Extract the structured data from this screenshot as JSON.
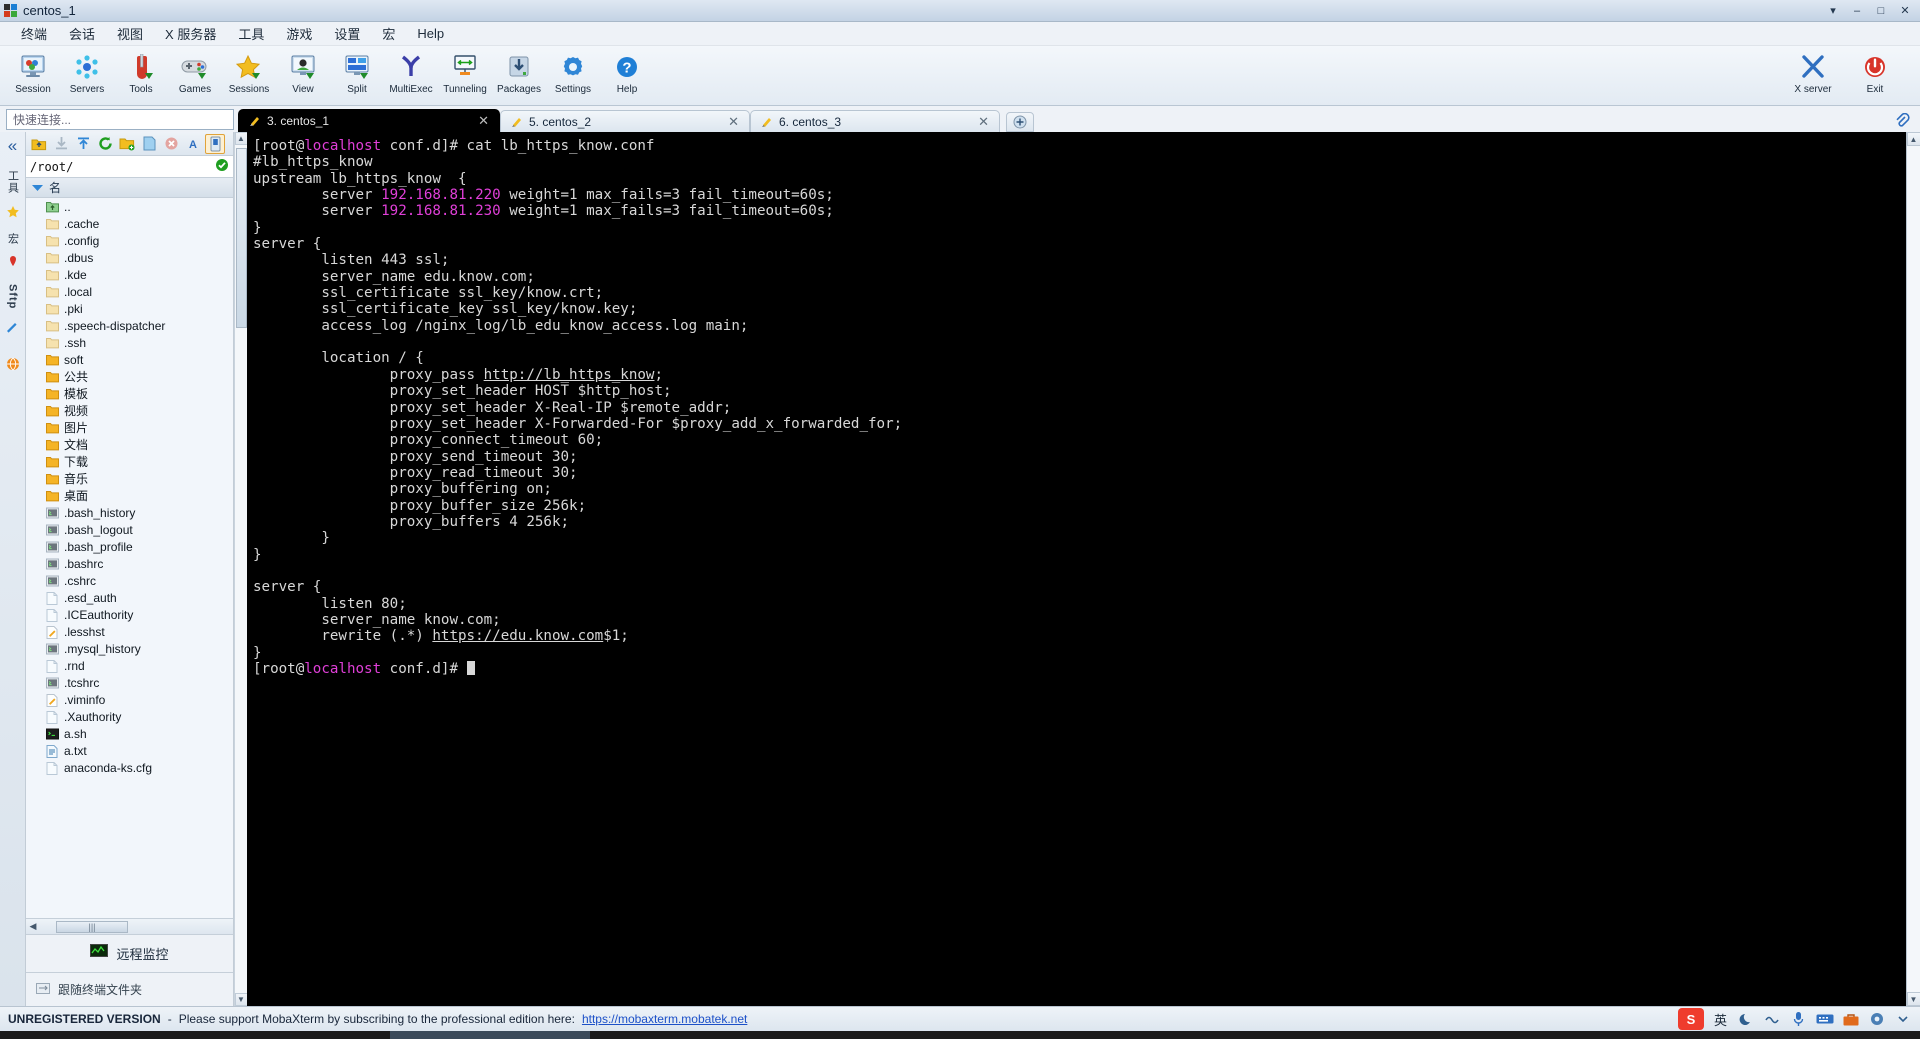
{
  "window": {
    "title": "centos_1",
    "buttons": [
      "▾",
      "–",
      "□",
      "✕"
    ]
  },
  "menu": {
    "items": [
      "终端",
      "会话",
      "视图",
      "X 服务器",
      "工具",
      "游戏",
      "设置",
      "宏",
      "Help"
    ]
  },
  "toolbar": {
    "items": [
      {
        "label": "Session",
        "icon": "session-icon"
      },
      {
        "label": "Servers",
        "icon": "servers-icon"
      },
      {
        "label": "Tools",
        "icon": "tools-icon"
      },
      {
        "label": "Games",
        "icon": "games-icon"
      },
      {
        "label": "Sessions",
        "icon": "sessions-star-icon"
      },
      {
        "label": "View",
        "icon": "view-icon"
      },
      {
        "label": "Split",
        "icon": "split-icon"
      },
      {
        "label": "MultiExec",
        "icon": "multiexec-icon"
      },
      {
        "label": "Tunneling",
        "icon": "tunneling-icon"
      },
      {
        "label": "Packages",
        "icon": "packages-icon"
      },
      {
        "label": "Settings",
        "icon": "settings-gear-icon"
      },
      {
        "label": "Help",
        "icon": "help-question-icon"
      }
    ],
    "right": [
      {
        "label": "X server",
        "icon": "x-server-icon"
      },
      {
        "label": "Exit",
        "icon": "power-exit-icon"
      }
    ]
  },
  "quick_connect": {
    "placeholder": "快速连接..."
  },
  "tabs": {
    "items": [
      {
        "label": "3. centos_1",
        "active": true,
        "close": "✕"
      },
      {
        "label": "5. centos_2",
        "active": false,
        "close": "✕"
      },
      {
        "label": "6. centos_3",
        "active": false,
        "close": "✕"
      }
    ],
    "add_label": "+"
  },
  "left_rail": {
    "chevron": "«",
    "labels": [
      "工具",
      "宏"
    ],
    "sftp_label": "Sftp"
  },
  "sidebar": {
    "path": "/root/",
    "path_ok_icon": "check-circle-icon",
    "column_header": "名",
    "sort_icon": "sort-descending-icon",
    "toolbar_icons": [
      "parent-folder-icon",
      "download-icon",
      "upload-icon",
      "refresh-icon",
      "new-folder-icon",
      "new-file-icon",
      "delete-icon",
      "text-mode-icon",
      "binary-mode-icon"
    ],
    "files": [
      {
        "name": "..",
        "type": "parent"
      },
      {
        "name": ".cache",
        "type": "folder-dim"
      },
      {
        "name": ".config",
        "type": "folder-dim"
      },
      {
        "name": ".dbus",
        "type": "folder-dim"
      },
      {
        "name": ".kde",
        "type": "folder-dim"
      },
      {
        "name": ".local",
        "type": "folder-dim"
      },
      {
        "name": ".pki",
        "type": "folder-dim"
      },
      {
        "name": ".speech-dispatcher",
        "type": "folder-dim"
      },
      {
        "name": ".ssh",
        "type": "folder-dim"
      },
      {
        "name": "soft",
        "type": "folder"
      },
      {
        "name": "公共",
        "type": "folder"
      },
      {
        "name": "模板",
        "type": "folder"
      },
      {
        "name": "视频",
        "type": "folder"
      },
      {
        "name": "图片",
        "type": "folder"
      },
      {
        "name": "文档",
        "type": "folder"
      },
      {
        "name": "下载",
        "type": "folder"
      },
      {
        "name": "音乐",
        "type": "folder"
      },
      {
        "name": "桌面",
        "type": "folder"
      },
      {
        "name": ".bash_history",
        "type": "script"
      },
      {
        "name": ".bash_logout",
        "type": "script"
      },
      {
        "name": ".bash_profile",
        "type": "script"
      },
      {
        "name": ".bashrc",
        "type": "script"
      },
      {
        "name": ".cshrc",
        "type": "script"
      },
      {
        "name": ".esd_auth",
        "type": "file"
      },
      {
        "name": ".ICEauthority",
        "type": "file"
      },
      {
        "name": ".lesshst",
        "type": "edit"
      },
      {
        "name": ".mysql_history",
        "type": "script"
      },
      {
        "name": ".rnd",
        "type": "file"
      },
      {
        "name": ".tcshrc",
        "type": "script"
      },
      {
        "name": ".viminfo",
        "type": "edit"
      },
      {
        "name": ".Xauthority",
        "type": "file"
      },
      {
        "name": "a.sh",
        "type": "shell"
      },
      {
        "name": "a.txt",
        "type": "text"
      },
      {
        "name": "anaconda-ks.cfg",
        "type": "file"
      }
    ],
    "footer_button": "远程监控",
    "footer_monitor_icon": "monitor-chart-icon",
    "footer_follow": "跟随终端文件夹",
    "footer_follow_icon": "folder-sync-icon"
  },
  "terminal": {
    "prompt_user": "[root@",
    "prompt_host": "localhost",
    "prompt_tail": " conf.d]# ",
    "command": "cat lb_https_know.conf",
    "lines": [
      {
        "segs": [
          {
            "t": "[root@",
            "c": "w"
          },
          {
            "t": "localhost",
            "c": "m"
          },
          {
            "t": " conf.d]# cat lb_https_know.conf",
            "c": "w"
          }
        ]
      },
      {
        "segs": [
          {
            "t": "#lb_https_know",
            "c": "w"
          }
        ]
      },
      {
        "segs": [
          {
            "t": "upstream lb_https_know  {",
            "c": "w"
          }
        ]
      },
      {
        "segs": [
          {
            "t": "        server ",
            "c": "w"
          },
          {
            "t": "192.168.81.220",
            "c": "m"
          },
          {
            "t": " weight=1 max_fails=3 fail_timeout=60s;",
            "c": "w"
          }
        ]
      },
      {
        "segs": [
          {
            "t": "        server ",
            "c": "w"
          },
          {
            "t": "192.168.81.230",
            "c": "m"
          },
          {
            "t": " weight=1 max_fails=3 fail_timeout=60s;",
            "c": "w"
          }
        ]
      },
      {
        "segs": [
          {
            "t": "}",
            "c": "w"
          }
        ]
      },
      {
        "segs": [
          {
            "t": "server {",
            "c": "w"
          }
        ]
      },
      {
        "segs": [
          {
            "t": "        listen 443 ssl;",
            "c": "w"
          }
        ]
      },
      {
        "segs": [
          {
            "t": "        server_name edu.know.com;",
            "c": "w"
          }
        ]
      },
      {
        "segs": [
          {
            "t": "        ssl_certificate ssl_key/know.crt;",
            "c": "w"
          }
        ]
      },
      {
        "segs": [
          {
            "t": "        ssl_certificate_key ssl_key/know.key;",
            "c": "w"
          }
        ]
      },
      {
        "segs": [
          {
            "t": "        access_log /nginx_log/lb_edu_know_access.log main;",
            "c": "w"
          }
        ]
      },
      {
        "segs": [
          {
            "t": "",
            "c": "w"
          }
        ]
      },
      {
        "segs": [
          {
            "t": "        location / {",
            "c": "w"
          }
        ]
      },
      {
        "segs": [
          {
            "t": "                proxy_pass ",
            "c": "w"
          },
          {
            "t": "http://lb_https_know",
            "c": "u"
          },
          {
            "t": ";",
            "c": "w"
          }
        ]
      },
      {
        "segs": [
          {
            "t": "                proxy_set_header HOST $http_host;",
            "c": "w"
          }
        ]
      },
      {
        "segs": [
          {
            "t": "                proxy_set_header X-Real-IP $remote_addr;",
            "c": "w"
          }
        ]
      },
      {
        "segs": [
          {
            "t": "                proxy_set_header X-Forwarded-For $proxy_add_x_forwarded_for;",
            "c": "w"
          }
        ]
      },
      {
        "segs": [
          {
            "t": "                proxy_connect_timeout 60;",
            "c": "w"
          }
        ]
      },
      {
        "segs": [
          {
            "t": "                proxy_send_timeout 30;",
            "c": "w"
          }
        ]
      },
      {
        "segs": [
          {
            "t": "                proxy_read_timeout 30;",
            "c": "w"
          }
        ]
      },
      {
        "segs": [
          {
            "t": "                proxy_buffering on;",
            "c": "w"
          }
        ]
      },
      {
        "segs": [
          {
            "t": "                proxy_buffer_size 256k;",
            "c": "w"
          }
        ]
      },
      {
        "segs": [
          {
            "t": "                proxy_buffers 4 256k;",
            "c": "w"
          }
        ]
      },
      {
        "segs": [
          {
            "t": "        }",
            "c": "w"
          }
        ]
      },
      {
        "segs": [
          {
            "t": "}",
            "c": "w"
          }
        ]
      },
      {
        "segs": [
          {
            "t": "",
            "c": "w"
          }
        ]
      },
      {
        "segs": [
          {
            "t": "server {",
            "c": "w"
          }
        ]
      },
      {
        "segs": [
          {
            "t": "        listen 80;",
            "c": "w"
          }
        ]
      },
      {
        "segs": [
          {
            "t": "        server_name know.com;",
            "c": "w"
          }
        ]
      },
      {
        "segs": [
          {
            "t": "        rewrite (.*) ",
            "c": "w"
          },
          {
            "t": "https://edu.know.com",
            "c": "u"
          },
          {
            "t": "$1;",
            "c": "w"
          }
        ]
      },
      {
        "segs": [
          {
            "t": "}",
            "c": "w"
          }
        ]
      },
      {
        "segs": [
          {
            "t": "[root@",
            "c": "w"
          },
          {
            "t": "localhost",
            "c": "m"
          },
          {
            "t": " conf.d]# ",
            "c": "w"
          },
          {
            "t": "",
            "c": "cursor"
          }
        ]
      }
    ],
    "colors": {
      "bg": "#000000",
      "fg": "#d8d8d8",
      "magenta": "#e03fd8"
    }
  },
  "statusbar": {
    "unregistered": "UNREGISTERED VERSION",
    "separator": "-",
    "message": "Please support MobaXterm by subscribing to the professional edition here:",
    "link": "https://mobaxterm.mobatek.net",
    "tray": {
      "ime_logo": "S",
      "ime_mode": "英",
      "icons": [
        "moon-icon",
        "wave-icon",
        "mic-icon",
        "keyboard-icon",
        "toolbox-icon",
        "settings-icon",
        "chevron-icon"
      ]
    }
  }
}
